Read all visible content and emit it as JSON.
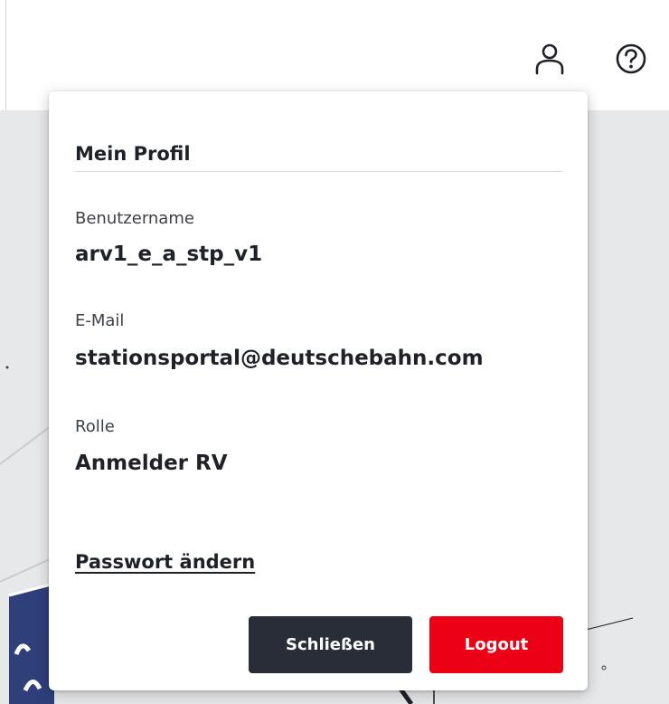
{
  "header": {
    "user_icon": "user-icon",
    "help_icon": "help-circle-icon"
  },
  "profile": {
    "title": "Mein Profil",
    "fields": [
      {
        "label": "Benutzername",
        "value": "arv1_e_a_stp_v1"
      },
      {
        "label": "E-Mail",
        "value": "stationsportal@deutschebahn.com"
      },
      {
        "label": "Rolle",
        "value": "Anmelder RV"
      }
    ],
    "change_password_label": "Passwort ändern",
    "close_label": "Schließen",
    "logout_label": "Logout"
  },
  "colors": {
    "primary_dark": "#282d37",
    "logout_red": "#ec0016",
    "text": "#1e2228"
  }
}
